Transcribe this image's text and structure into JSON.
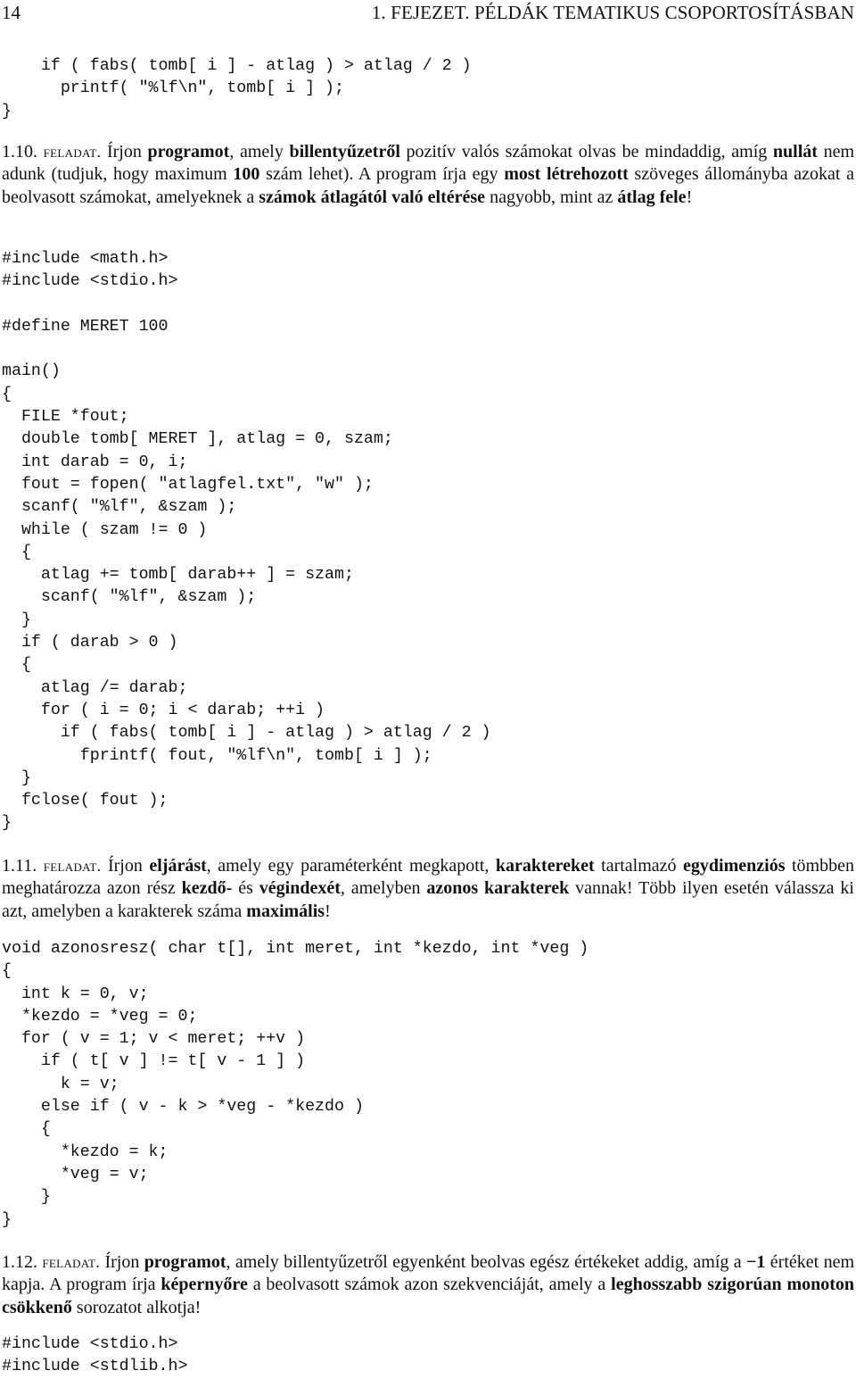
{
  "header": {
    "page_number": "14",
    "chapter_title": "1. FEJEZET. PÉLDÁK TEMATIKUS CSOPORTOSÍTÁSBAN"
  },
  "code_blocks": [
    {
      "lines": [
        "    if ( fabs( tomb[ i ] - atlag ) > atlag / 2 )",
        "      printf( \"%lf\\n\", tomb[ i ] );",
        "}"
      ]
    },
    {
      "lines": [
        "#include <math.h>",
        "#include <stdio.h>",
        "",
        "#define MERET 100",
        "",
        "main()",
        "{",
        "  FILE *fout;",
        "  double tomb[ MERET ], atlag = 0, szam;",
        "  int darab = 0, i;",
        "  fout = fopen( \"atlagfel.txt\", \"w\" );",
        "  scanf( \"%lf\", &szam );",
        "  while ( szam != 0 )",
        "  {",
        "    atlag += tomb[ darab++ ] = szam;",
        "    scanf( \"%lf\", &szam );",
        "  }",
        "  if ( darab > 0 )",
        "  {",
        "    atlag /= darab;",
        "    for ( i = 0; i < darab; ++i )",
        "      if ( fabs( tomb[ i ] - atlag ) > atlag / 2 )",
        "        fprintf( fout, \"%lf\\n\", tomb[ i ] );",
        "  }",
        "  fclose( fout );",
        "}"
      ]
    },
    {
      "lines": [
        "void azonosresz( char t[], int meret, int *kezdo, int *veg )",
        "{",
        "  int k = 0, v;",
        "  *kezdo = *veg = 0;",
        "  for ( v = 1; v < meret; ++v )",
        "    if ( t[ v ] != t[ v - 1 ] )",
        "      k = v;",
        "    else if ( v - k > *veg - *kezdo )",
        "    {",
        "      *kezdo = k;",
        "      *veg = v;",
        "    }",
        "}"
      ]
    },
    {
      "lines": [
        "#include <stdio.h>",
        "#include <stdlib.h>"
      ]
    }
  ],
  "exercises": [
    {
      "number": "1.10.",
      "label": "feladat.",
      "segments": [
        {
          "text": "Írjon ",
          "bold": false
        },
        {
          "text": "programot",
          "bold": true
        },
        {
          "text": ", amely ",
          "bold": false
        },
        {
          "text": "billentyűzetről",
          "bold": true
        },
        {
          "text": " pozitív valós számokat olvas be mindaddig, amíg ",
          "bold": false
        },
        {
          "text": "nullát",
          "bold": true
        },
        {
          "text": " nem adunk (tudjuk, hogy maximum ",
          "bold": false
        },
        {
          "text": "100",
          "bold": true
        },
        {
          "text": " szám lehet). A program írja egy ",
          "bold": false
        },
        {
          "text": "most létrehozott",
          "bold": true
        },
        {
          "text": " szöveges állományba azokat a beolvasott számokat, amelyeknek a ",
          "bold": false
        },
        {
          "text": "számok átlagától való eltérése",
          "bold": true
        },
        {
          "text": " nagyobb, mint az ",
          "bold": false
        },
        {
          "text": "átlag fele",
          "bold": true
        },
        {
          "text": "!",
          "bold": false
        }
      ]
    },
    {
      "number": "1.11.",
      "label": "feladat.",
      "segments": [
        {
          "text": "Írjon ",
          "bold": false
        },
        {
          "text": "eljárást",
          "bold": true
        },
        {
          "text": ", amely egy paraméterként megkapott, ",
          "bold": false
        },
        {
          "text": "karaktereket",
          "bold": true
        },
        {
          "text": " tartalmazó ",
          "bold": false
        },
        {
          "text": "egydimenziós",
          "bold": true
        },
        {
          "text": " tömbben meghatározza azon rész ",
          "bold": false
        },
        {
          "text": "kezdő-",
          "bold": true
        },
        {
          "text": " és ",
          "bold": false
        },
        {
          "text": "végindexét",
          "bold": true
        },
        {
          "text": ", amelyben ",
          "bold": false
        },
        {
          "text": "azonos karakterek",
          "bold": true
        },
        {
          "text": " vannak! Több ilyen esetén válassza ki azt, amelyben a karakterek száma ",
          "bold": false
        },
        {
          "text": "maximális",
          "bold": true
        },
        {
          "text": "!",
          "bold": false
        }
      ]
    },
    {
      "number": "1.12.",
      "label": "feladat.",
      "segments": [
        {
          "text": "Írjon ",
          "bold": false
        },
        {
          "text": "programot",
          "bold": true
        },
        {
          "text": ", amely billentyűzetről egyenként beolvas egész értékeket addig, amíg a ",
          "bold": false
        },
        {
          "text": "−1",
          "bold": true
        },
        {
          "text": " értéket nem kapja. A program írja ",
          "bold": false
        },
        {
          "text": "képernyőre",
          "bold": true
        },
        {
          "text": " a beolvasott számok azon szekvenciáját, amely a ",
          "bold": false
        },
        {
          "text": "leghosszabb szigorúan monoton csökkenő",
          "bold": true
        },
        {
          "text": " sorozatot alkotja!",
          "bold": false
        }
      ]
    }
  ]
}
